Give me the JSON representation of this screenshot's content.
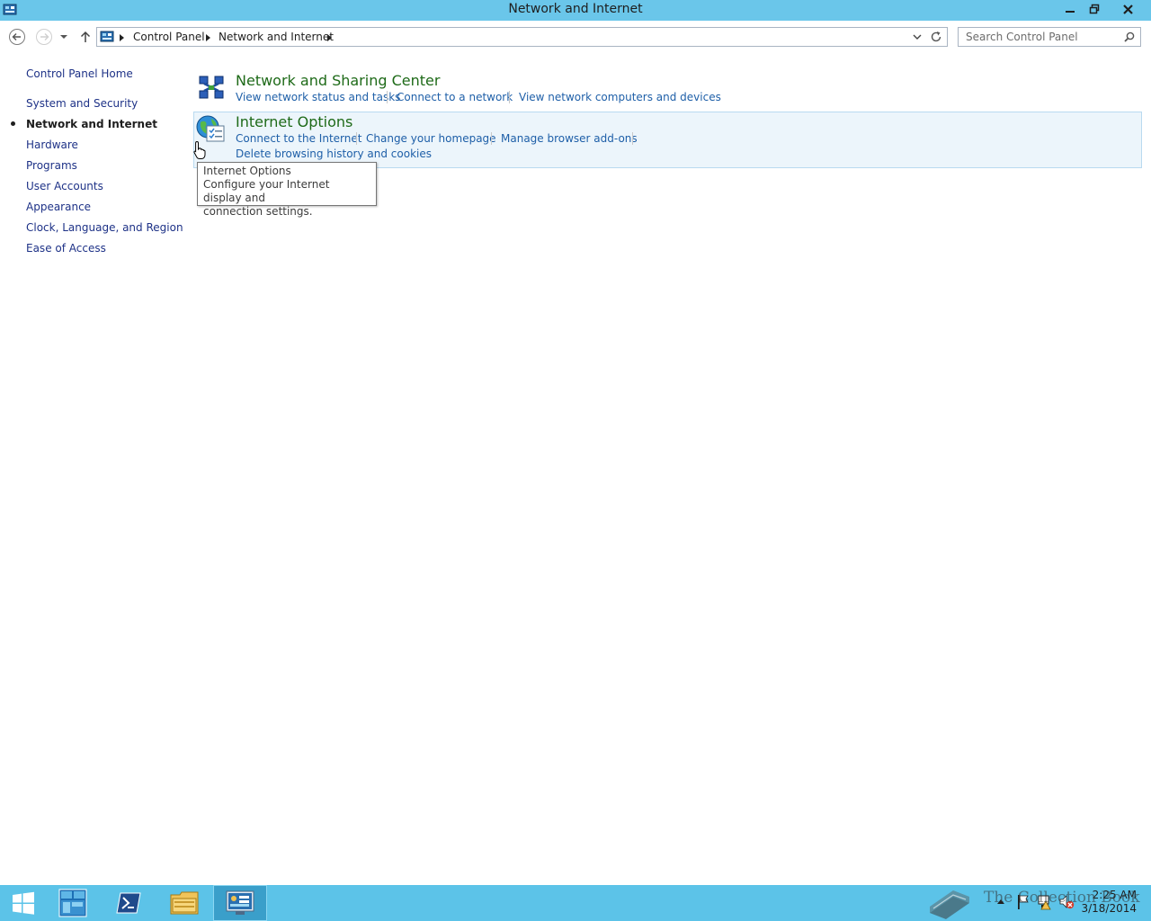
{
  "window": {
    "title": "Network and Internet"
  },
  "address_bar": {
    "crumbs": [
      "Control Panel",
      "Network and Internet"
    ]
  },
  "search": {
    "placeholder": "Search Control Panel"
  },
  "left_nav": {
    "items": [
      {
        "label": "Control Panel Home"
      },
      {
        "label": "System and Security"
      },
      {
        "label": "Network and Internet",
        "current": true
      },
      {
        "label": "Hardware"
      },
      {
        "label": "Programs"
      },
      {
        "label": "User Accounts"
      },
      {
        "label": "Appearance"
      },
      {
        "label": "Clock, Language, and Region"
      },
      {
        "label": "Ease of Access"
      }
    ]
  },
  "categories": [
    {
      "title": "Network and Sharing Center",
      "icon": "network-sharing-icon",
      "tasks": [
        "View network status and tasks",
        "Connect to a network",
        "View network computers and devices"
      ]
    },
    {
      "title": "Internet Options",
      "icon": "internet-options-icon",
      "tasks": [
        "Connect to the Internet",
        "Change your homepage",
        "Manage browser add-ons",
        "Delete browsing history and cookies"
      ]
    }
  ],
  "tooltip": {
    "title": "Internet Options",
    "line1": "Configure your Internet display and",
    "line2": "connection settings."
  },
  "taskbar": {
    "buttons": [
      "start-icon",
      "server-manager-icon",
      "powershell-icon",
      "file-explorer-icon",
      "control-panel-icon"
    ],
    "active": "control-panel-icon",
    "time": "2:25 AM",
    "date": "3/18/2014"
  },
  "watermark": {
    "text": "The Collection Book"
  },
  "colors": {
    "titlebar": "#6ac6ea",
    "taskbar": "#5cc3e8",
    "category_title": "#1e6a18",
    "link": "#1e5fa8"
  }
}
